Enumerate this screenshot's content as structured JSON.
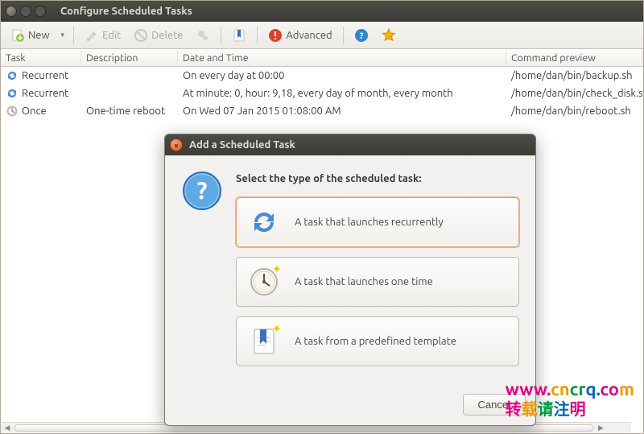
{
  "window": {
    "title": "Configure Scheduled Tasks"
  },
  "toolbar": {
    "new": "New",
    "edit": "Edit",
    "delete": "Delete",
    "advanced": "Advanced"
  },
  "columns": {
    "task": "Task",
    "description": "Description",
    "datetime": "Date and Time",
    "command": "Command preview"
  },
  "rows": [
    {
      "icon": "recurrent",
      "task": "Recurrent",
      "description": "",
      "datetime": "On every day at 00:00",
      "command": "/home/dan/bin/backup.sh"
    },
    {
      "icon": "recurrent",
      "task": "Recurrent",
      "description": "",
      "datetime": "At minute: 0, hour: 9,18, every day of month, every month",
      "command": "/home/dan/bin/check_disk.sh"
    },
    {
      "icon": "once",
      "task": "Once",
      "description": "One-time reboot",
      "datetime": "On Wed 07 Jan 2015 01:08:00 AM",
      "command": "/home/dan/bin/reboot.sh"
    }
  ],
  "dialog": {
    "title": "Add a Scheduled Task",
    "heading": "Select the type of the scheduled task:",
    "options": [
      {
        "label": "A task that launches recurrently",
        "icon": "recurrent",
        "selected": true
      },
      {
        "label": "A task that launches one time",
        "icon": "clock",
        "selected": false
      },
      {
        "label": "A task from a predefined template",
        "icon": "template",
        "selected": false
      }
    ],
    "cancel": "Cancel"
  },
  "watermark": {
    "line1": "www.cncrq.com",
    "line2": "转载请注明"
  }
}
